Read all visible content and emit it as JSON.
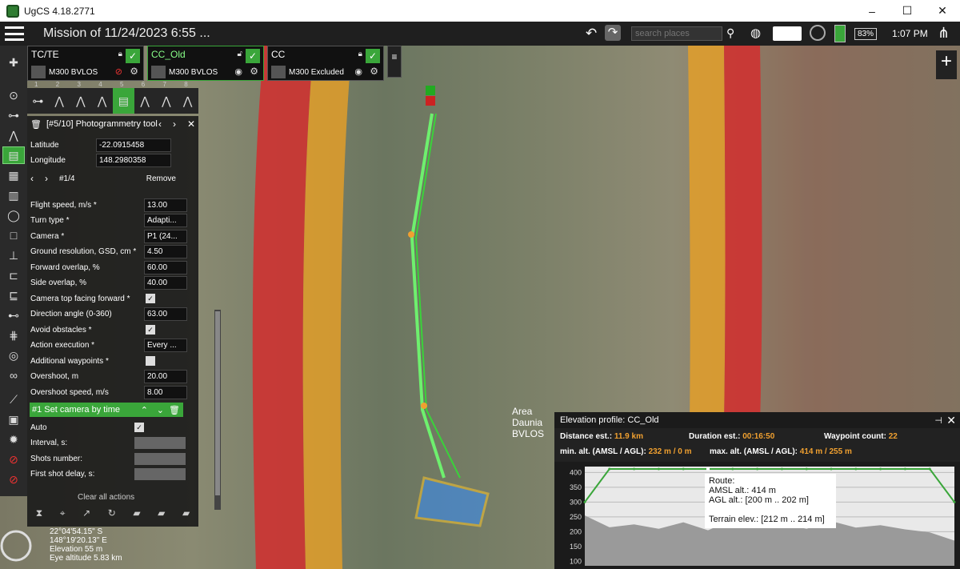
{
  "window": {
    "title": "UgCS 4.18.2771",
    "controls": [
      "–",
      "☐",
      "✕"
    ]
  },
  "topbar": {
    "mission_title": "Mission of 11/24/2023 6:55 ...",
    "search_placeholder": "search places",
    "battery": "83%",
    "time": "1:07 PM"
  },
  "vehicles": [
    {
      "name": "TC/TE",
      "type": "M300 BVLOS"
    },
    {
      "name": "CC_Old",
      "type": "M300 BVLOS"
    },
    {
      "name": "CC",
      "type": "M300 Excluded"
    }
  ],
  "route_tools": {
    "numbers": [
      "1",
      "2",
      "3",
      "4",
      "5",
      "6",
      "7",
      "8"
    ]
  },
  "tool_panel": {
    "header": "[#5/10] Photogrammetry tool",
    "latitude_label": "Latitude",
    "latitude": "-22.0915458",
    "longitude_label": "Longitude",
    "longitude": "148.2980358",
    "nav_index": "#1/4",
    "remove_label": "Remove",
    "fields": [
      {
        "label": "Flight speed, m/s *",
        "value": "13.00"
      },
      {
        "label": "Turn type *",
        "value": "Adapti..."
      },
      {
        "label": "Camera *",
        "value": "P1 (24..."
      },
      {
        "label": "Ground resolution, GSD, cm *",
        "value": "4.50"
      },
      {
        "label": "Forward overlap, %",
        "value": "60.00"
      },
      {
        "label": "Side overlap, %",
        "value": "40.00"
      },
      {
        "label": "Camera top facing forward *",
        "value": "✓"
      },
      {
        "label": "Direction angle (0-360)",
        "value": "63.00"
      },
      {
        "label": "Avoid obstacles *",
        "value": "✓"
      },
      {
        "label": "Action execution *",
        "value": "Every ..."
      },
      {
        "label": "Additional waypoints *",
        "value": ""
      },
      {
        "label": "Overshoot, m",
        "value": "20.00"
      },
      {
        "label": "Overshoot speed, m/s",
        "value": "8.00"
      }
    ]
  },
  "action": {
    "title": "#1 Set camera by time",
    "fields": [
      {
        "label": "Auto",
        "value": "✓"
      },
      {
        "label": "Interval, s:",
        "value": ""
      },
      {
        "label": "Shots number:",
        "value": ""
      },
      {
        "label": "First shot delay, s:",
        "value": ""
      }
    ],
    "clear_label": "Clear all actions"
  },
  "status": {
    "lat": "22°04'54.15\" S",
    "lon": "148°19'20.13\" E",
    "elevation": "Elevation 55 m",
    "eye": "Eye altitude 5.83 km"
  },
  "map": {
    "area_label": "Area\nDaunia\nBVLOS"
  },
  "elevation_profile": {
    "title": "Elevation profile: CC_Old",
    "distance_label": "Distance est.:",
    "distance": "11.9 km",
    "duration_label": "Duration est.:",
    "duration": "00:16:50",
    "waypoints_label": "Waypoint count:",
    "waypoints": "22",
    "min_label": "min. alt. (AMSL / AGL):",
    "min": "232 m / 0 m",
    "max_label": "max. alt. (AMSL / AGL):",
    "max": "414 m / 255 m",
    "tooltip": {
      "l1": "Route:",
      "l2": "AMSL alt.: 414 m",
      "l3": "AGL alt.: [200 m .. 202 m]",
      "l4": "Terrain elev.: [212 m .. 214 m]"
    }
  },
  "chart_data": {
    "type": "area",
    "yticks": [
      100,
      150,
      200,
      250,
      300,
      350,
      400
    ],
    "ylim": [
      85,
      420
    ],
    "series": [
      {
        "values": [
          300,
          412,
          412,
          412,
          412,
          412,
          412,
          412,
          412,
          412,
          412,
          412,
          412,
          412,
          412,
          300
        ]
      },
      {
        "values": [
          255,
          215,
          225,
          210,
          232,
          205,
          240,
          218,
          228,
          210,
          236,
          214,
          222,
          208,
          198,
          170
        ]
      }
    ]
  },
  "colors": {
    "accent": "#3aa63a",
    "orange": "#f0a030",
    "panel": "#1b1b1b"
  }
}
